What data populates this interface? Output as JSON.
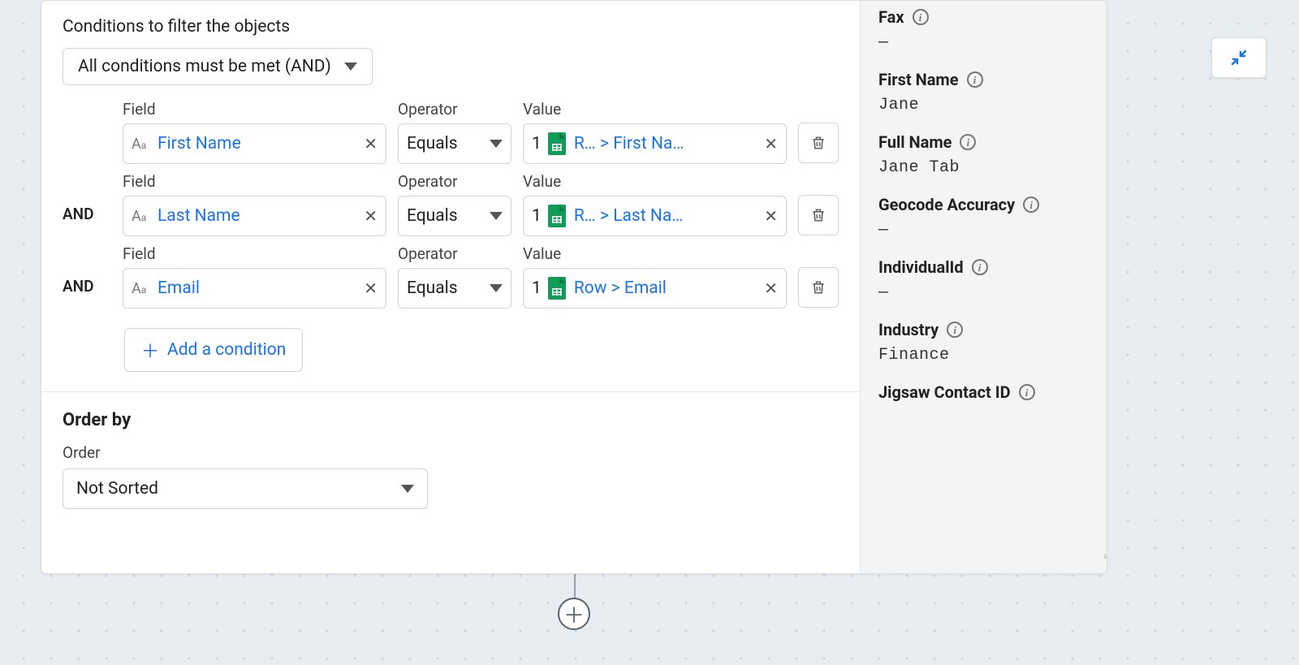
{
  "filter_section_title": "Conditions to filter the objects",
  "conditions_mode": "All conditions must be met (AND)",
  "labels": {
    "field": "Field",
    "operator": "Operator",
    "value": "Value",
    "and": "AND"
  },
  "rows": [
    {
      "field": "First Name",
      "operator": "Equals",
      "value_index": "1",
      "value_text": "R…  > First Na…"
    },
    {
      "field": "Last Name",
      "operator": "Equals",
      "value_index": "1",
      "value_text": "R…  > Last Na…"
    },
    {
      "field": "Email",
      "operator": "Equals",
      "value_index": "1",
      "value_text": "Row > Email"
    }
  ],
  "add_condition_label": "Add a condition",
  "order_by_title": "Order by",
  "order_label": "Order",
  "order_value": "Not Sorted",
  "side_panel": [
    {
      "label": "Fax",
      "value": "—"
    },
    {
      "label": "First Name",
      "value": "Jane"
    },
    {
      "label": "Full Name",
      "value": "Jane Tab"
    },
    {
      "label": "Geocode Accuracy",
      "value": "—"
    },
    {
      "label": "IndividualId",
      "value": "—"
    },
    {
      "label": "Industry",
      "value": "Finance"
    },
    {
      "label": "Jigsaw Contact ID",
      "value": ""
    }
  ]
}
